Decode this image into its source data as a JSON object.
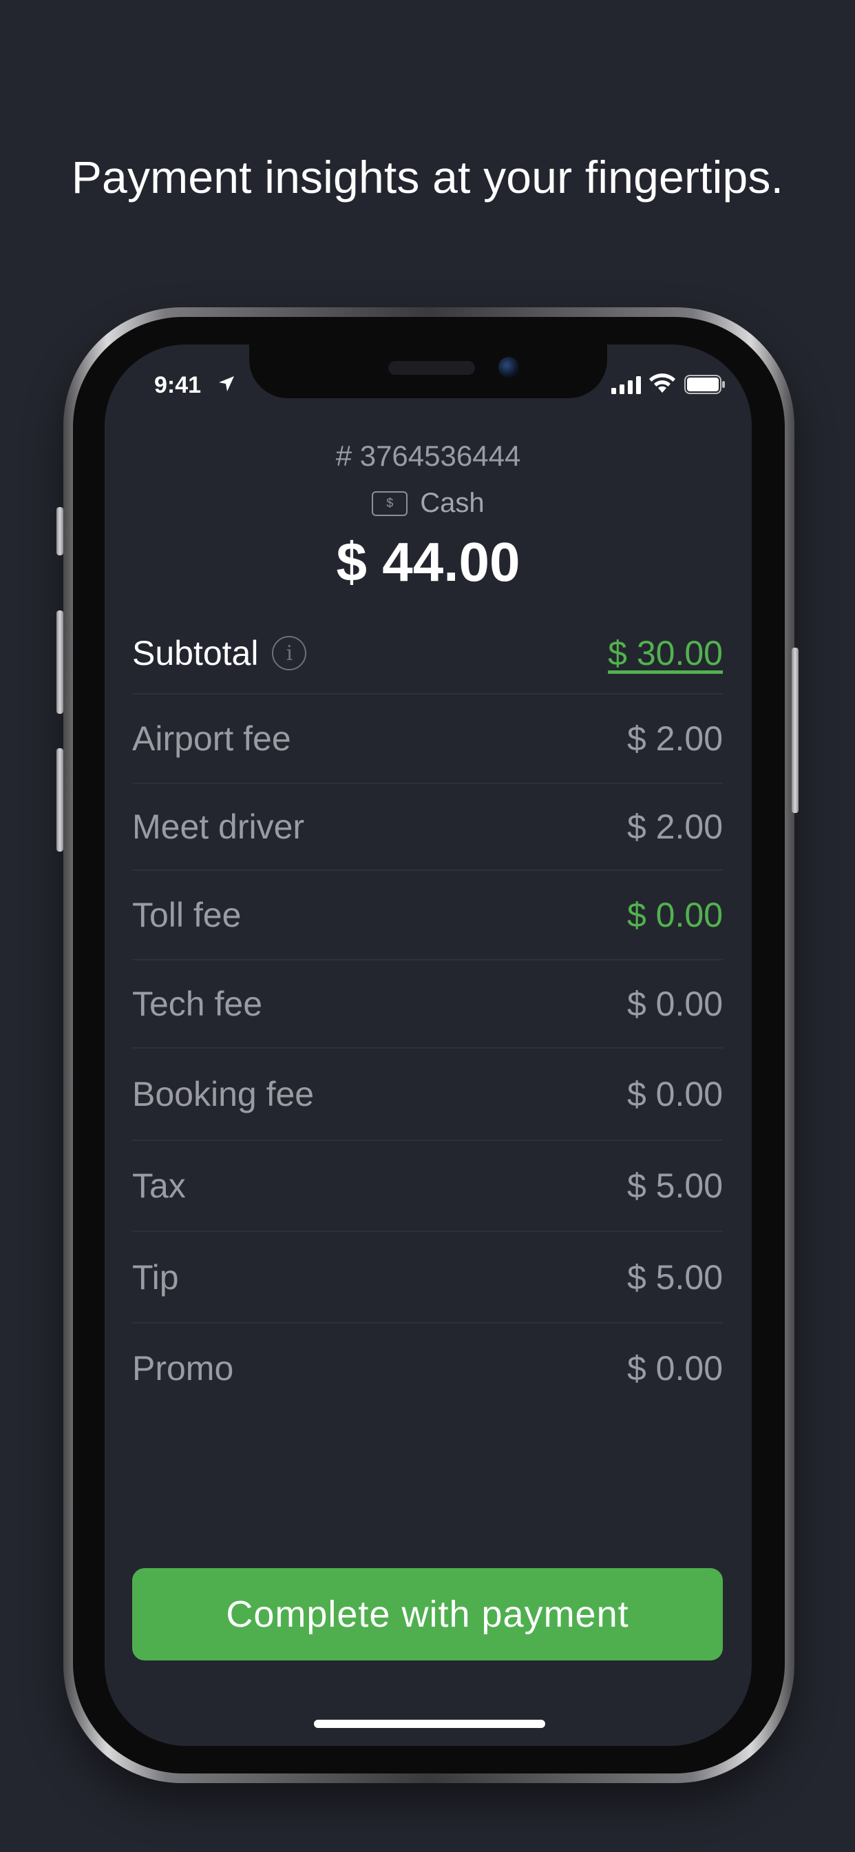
{
  "headline": "Payment insights at your fingertips.",
  "status_bar": {
    "time": "9:41"
  },
  "order": {
    "id": "# 3764536444",
    "payment_method": "Cash",
    "cash_icon_glyph": "$",
    "total": "$ 44.00"
  },
  "breakdown": {
    "subtotal": {
      "label": "Subtotal",
      "value": "$ 30.00"
    },
    "items": [
      {
        "label": "Airport fee",
        "value": "$ 2.00"
      },
      {
        "label": "Meet driver",
        "value": "$ 2.00"
      },
      {
        "label": "Toll fee",
        "value": "$ 0.00"
      },
      {
        "label": "Tech fee",
        "value": "$ 0.00"
      },
      {
        "label": "Booking fee",
        "value": "$ 0.00"
      },
      {
        "label": "Tax",
        "value": "$ 5.00"
      },
      {
        "label": "Tip",
        "value": "$ 5.00"
      },
      {
        "label": "Promo",
        "value": "$ 0.00"
      }
    ]
  },
  "actions": {
    "complete_label": "Complete with payment"
  },
  "colors": {
    "background": "#24262f",
    "accent_green": "#4faf4f",
    "muted_text": "#9b9ca3"
  },
  "icons": [
    "location-arrow-icon",
    "signal-icon",
    "wifi-icon",
    "battery-icon",
    "cash-icon",
    "info-icon"
  ]
}
